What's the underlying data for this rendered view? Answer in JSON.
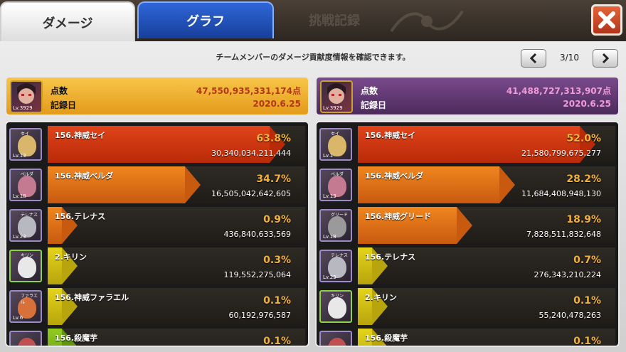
{
  "tabs": {
    "damage": "ダメージ",
    "graph": "グラフ",
    "record": "挑戦記録"
  },
  "close_icon": "close-icon",
  "info_text": "チームメンバーのダメージ貢献度情報を確認できます。",
  "pager": {
    "label": "3/10",
    "prev_icon": "chevron-left-icon",
    "next_icon": "chevron-right-icon"
  },
  "summary_left": {
    "avatar_level": "Lv.3929",
    "score_label": "点数",
    "score": "47,550,935,331,174点",
    "date_label": "記録日",
    "date": "2020.6.25"
  },
  "summary_right": {
    "avatar_level": "Lv.3929",
    "score_label": "点数",
    "score": "41,488,727,313,907点",
    "date_label": "記録日",
    "date": "2020.6.25"
  },
  "colors": {
    "red_bar": "#d23a10",
    "orange_bar": "#e8741a",
    "yellow_bar": "#d8cc1a",
    "green_bar": "#88c21a",
    "pct_text": "#f5b23a"
  },
  "left_rows": [
    {
      "avatar_tag": "セイ",
      "level": "Lv.13",
      "name": "156.神威セイ",
      "percent": "63.8%",
      "damage": "30,340,034,211,444",
      "fill": 0.94,
      "color": "red",
      "face": "#d9b66a"
    },
    {
      "avatar_tag": "ベルダ",
      "level": "Lv.18",
      "name": "156.神威ベルダ",
      "percent": "34.7%",
      "damage": "16,505,042,642,605",
      "fill": 0.58,
      "color": "orange",
      "face": "#c47a90"
    },
    {
      "avatar_tag": "テレナス",
      "level": "Lv.23",
      "name": "156.テレナス",
      "percent": "0.9%",
      "damage": "436,840,633,569",
      "fill": 0.06,
      "color": "orange",
      "face": "#b8b8c0"
    },
    {
      "avatar_tag": "キリン",
      "level": "",
      "name": "2.キリン",
      "percent": "0.3%",
      "damage": "119,552,275,064",
      "fill": 0.06,
      "color": "yellow",
      "face": "#e8e8e8"
    },
    {
      "avatar_tag": "ファラエル",
      "level": "Lv.6",
      "name": "156.神威ファラエル",
      "percent": "0.1%",
      "damage": "60,192,976,587",
      "fill": 0.06,
      "color": "yellow",
      "face": "#d8703a"
    },
    {
      "avatar_tag": "",
      "level": "",
      "name": "156.殺魔芋",
      "percent": "0.1%",
      "damage": "",
      "fill": 0.06,
      "color": "green",
      "face": "#c05050"
    }
  ],
  "right_rows": [
    {
      "avatar_tag": "セイ",
      "level": "Lv.1",
      "name": "156.神威セイ",
      "percent": "52.0%",
      "damage": "21,580,799,675,277",
      "fill": 0.94,
      "color": "red",
      "face": "#d9b66a"
    },
    {
      "avatar_tag": "ベルダ",
      "level": "Lv.13",
      "name": "156.神威ベルダ",
      "percent": "28.2%",
      "damage": "11,684,408,948,130",
      "fill": 0.6,
      "color": "orange",
      "face": "#c47a90"
    },
    {
      "avatar_tag": "グリード",
      "level": "Lv.18",
      "name": "156.神威グリード",
      "percent": "18.9%",
      "damage": "7,828,511,832,648",
      "fill": 0.42,
      "color": "orange",
      "face": "#9a9a9a"
    },
    {
      "avatar_tag": "テレナス",
      "level": "Lv.23",
      "name": "156.テレナス",
      "percent": "0.7%",
      "damage": "276,343,210,224",
      "fill": 0.06,
      "color": "yellow",
      "face": "#b8b8c0"
    },
    {
      "avatar_tag": "キリン",
      "level": "",
      "name": "2.キリン",
      "percent": "0.1%",
      "damage": "55,240,478,263",
      "fill": 0.06,
      "color": "yellow",
      "face": "#e8e8e8"
    },
    {
      "avatar_tag": "",
      "level": "",
      "name": "156.殺魔芋",
      "percent": "0.1%",
      "damage": "",
      "fill": 0.06,
      "color": "yellow",
      "face": "#c05050"
    }
  ]
}
